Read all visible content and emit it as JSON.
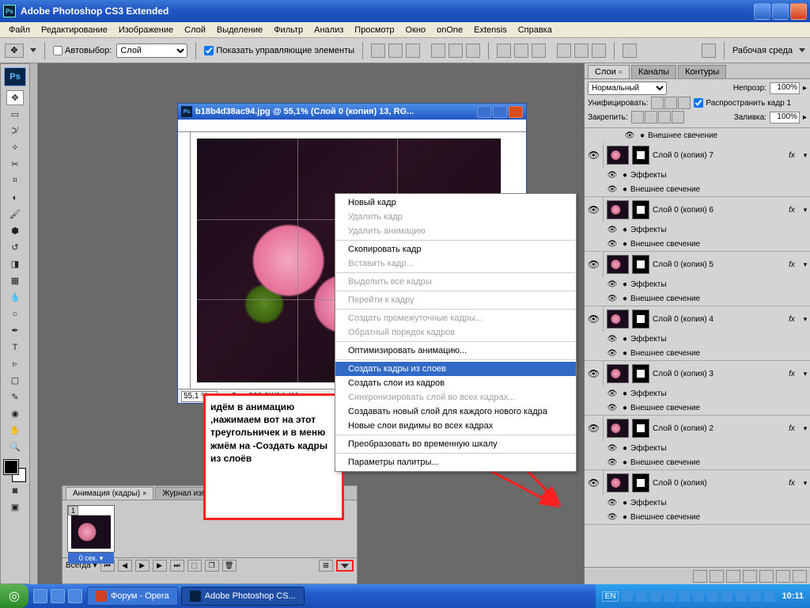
{
  "app": {
    "title": "Adobe Photoshop CS3 Extended",
    "ps_abbr": "Ps"
  },
  "menu": [
    "Файл",
    "Редактирование",
    "Изображение",
    "Слой",
    "Выделение",
    "Фильтр",
    "Анализ",
    "Просмотр",
    "Окно",
    "onOne",
    "Extensis",
    "Справка"
  ],
  "optbar": {
    "autoselect_label": "Автовыбор:",
    "autoselect_value": "Слой",
    "show_controls": "Показать управляющие элементы",
    "workspace": "Рабочая среда"
  },
  "document": {
    "title": "b18b4d38ac94.jpg @ 55,1% (Слой 0 (копия) 13, RG...",
    "zoom": "55,1 %",
    "docinfo": "Док: 900,0K/14,4M"
  },
  "layers_panel": {
    "tabs": [
      "Слои",
      "Каналы",
      "Контуры"
    ],
    "blend": "Нормальный",
    "opacity_label": "Непрозр:",
    "opacity": "100%",
    "unify_label": "Унифицировать:",
    "propagate": "Распространить кадр 1",
    "lock_label": "Закрепить:",
    "fill_label": "Заливка:",
    "fill": "100%",
    "top_effect": "Внешнее свечение",
    "effects_label": "Эффекты",
    "glow_label": "Внешнее свечение",
    "fx": "fx",
    "layers": [
      "Слой 0 (копия) 7",
      "Слой 0 (копия) 6",
      "Слой 0 (копия) 5",
      "Слой 0 (копия) 4",
      "Слой 0 (копия) 3",
      "Слой 0 (копия) 2",
      "Слой 0 (копия)"
    ]
  },
  "anim": {
    "tab1": "Анимация (кадры)",
    "tab2": "Журнал измере",
    "frame_num": "1",
    "frame_time": "0 сек.",
    "loop": "Всегда"
  },
  "ctxmenu": [
    {
      "t": "Новый кадр",
      "d": false
    },
    {
      "t": "Удалить кадр",
      "d": true
    },
    {
      "t": "Удалить анимацию",
      "d": true
    },
    {
      "sep": true
    },
    {
      "t": "Скопировать кадр",
      "d": false
    },
    {
      "t": "Вставить кадр...",
      "d": true
    },
    {
      "sep": true
    },
    {
      "t": "Выделить все кадры",
      "d": true
    },
    {
      "sep": true
    },
    {
      "t": "Перейти к кадру",
      "d": true
    },
    {
      "sep": true
    },
    {
      "t": "Создать промежуточные кадры...",
      "d": true
    },
    {
      "t": "Обратный порядок кадров",
      "d": true
    },
    {
      "sep": true
    },
    {
      "t": "Оптимизировать анимацию...",
      "d": false
    },
    {
      "sep": true
    },
    {
      "t": "Создать кадры из слоев",
      "d": false,
      "hl": true
    },
    {
      "t": "Создать слои из кадров",
      "d": false
    },
    {
      "t": "Синхронизировать слой во всех кадрах...",
      "d": true
    },
    {
      "t": "Создавать новый слой для каждого нового кадра",
      "d": false
    },
    {
      "t": "Новые слои видимы во всех кадрах",
      "d": false
    },
    {
      "sep": true
    },
    {
      "t": "Преобразовать во временную шкалу",
      "d": false
    },
    {
      "sep": true
    },
    {
      "t": "Параметры палитры...",
      "d": false
    }
  ],
  "annotation": "идём в анимацию ,нажимаем вот на этот треугольничек и в меню жмём на -Создать кадры из слоёв",
  "taskbar": {
    "task1": "Форум - Opera",
    "task2": "Adobe Photoshop CS...",
    "lang": "EN",
    "clock": "10:11"
  }
}
